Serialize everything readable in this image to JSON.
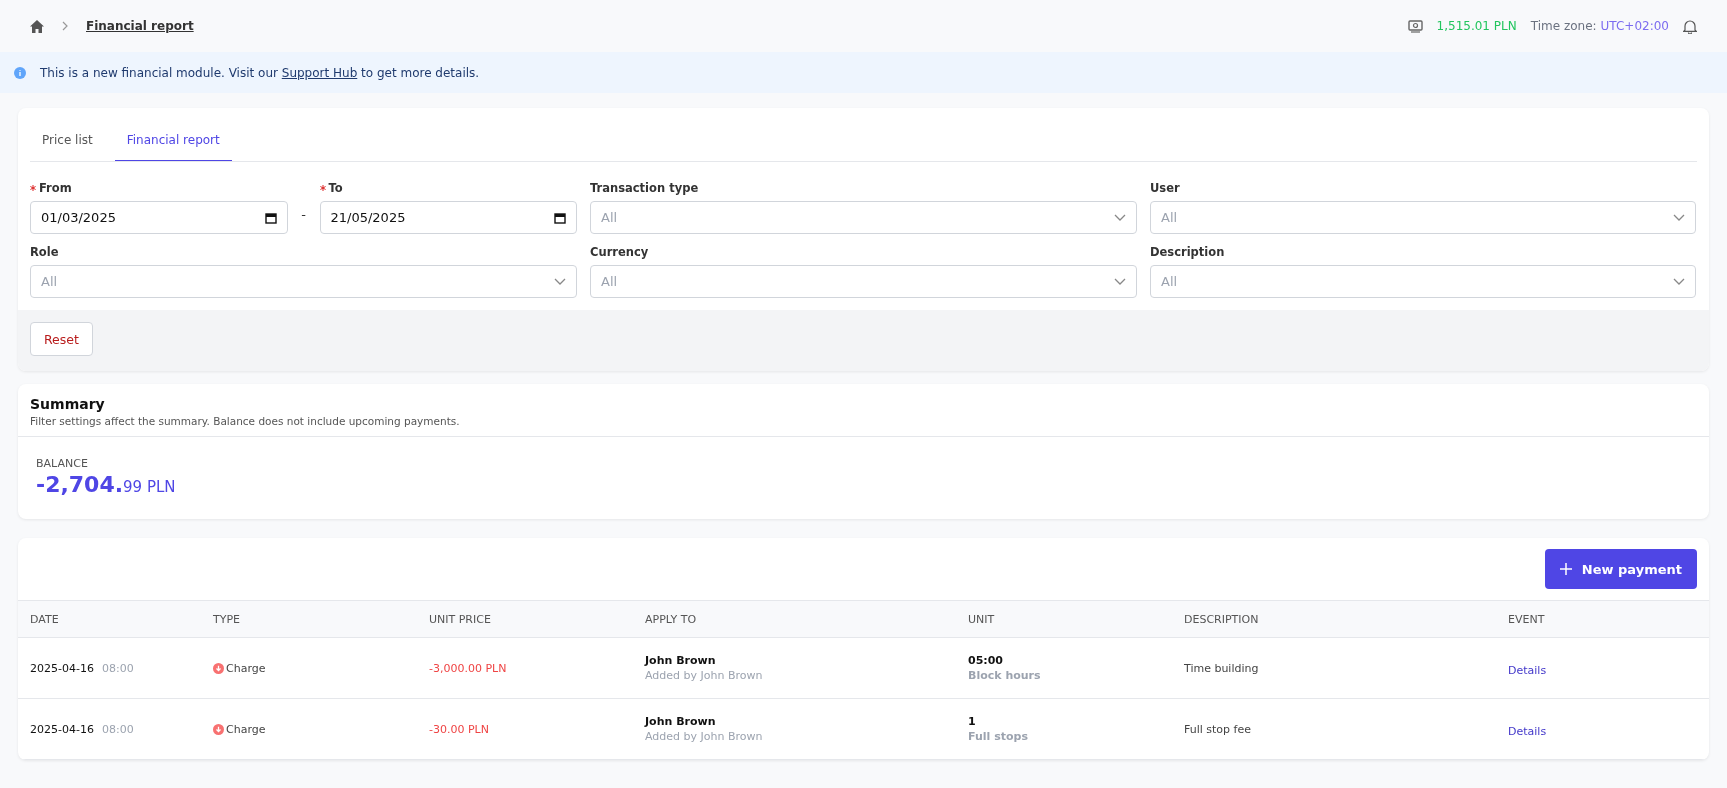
{
  "breadcrumb": {
    "current": "Financial report"
  },
  "header": {
    "balance": "1,515.01 PLN",
    "timezone_label": "Time zone:",
    "timezone": "UTC+02:00"
  },
  "banner": {
    "before": "This is a new financial module. Visit our ",
    "link": "Support Hub",
    "after": " to get more details."
  },
  "tabs": [
    {
      "label": "Price list",
      "selected": false
    },
    {
      "label": "Financial report",
      "selected": true
    }
  ],
  "filters": {
    "range_separator": "-",
    "dates": [
      {
        "label": "From",
        "required": true,
        "value": "01/03/2025"
      },
      {
        "label": "To",
        "required": true,
        "value": "21/05/2025"
      }
    ],
    "selects": [
      {
        "label": "Transaction type",
        "placeholder": "All"
      },
      {
        "label": "User",
        "placeholder": "All"
      },
      {
        "label": "Role",
        "placeholder": "All"
      },
      {
        "label": "Currency",
        "placeholder": "All"
      },
      {
        "label": "Description",
        "placeholder": "All"
      }
    ],
    "reset": "Reset"
  },
  "summary": {
    "title": "Summary",
    "subtitle": "Filter settings affect the summary. Balance does not include upcoming payments.",
    "balance_label": "BALANCE",
    "balance_whole": "-2,704.",
    "balance_fraction": "99 PLN"
  },
  "table": {
    "new_payment": "New payment",
    "columns": [
      "DATE",
      "TYPE",
      "UNIT PRICE",
      "APPLY TO",
      "UNIT",
      "DESCRIPTION",
      "EVENT"
    ],
    "rows": [
      {
        "date": "2025-04-16",
        "time": "08:00",
        "type": {
          "kind": "charge",
          "label": "Charge"
        },
        "unit_price": "-3,000.00 PLN",
        "apply_to": "John Brown",
        "added_by": "Added by John Brown",
        "unit_value": "05:00",
        "unit_label": "Block hours",
        "description": "Time building",
        "event": "Details"
      },
      {
        "date": "2025-04-16",
        "time": "08:00",
        "type": {
          "kind": "charge",
          "label": "Charge"
        },
        "unit_price": "-30.00 PLN",
        "apply_to": "John Brown",
        "added_by": "Added by John Brown",
        "unit_value": "1",
        "unit_label": "Full stops",
        "description": "Full stop fee",
        "event": "Details"
      }
    ]
  }
}
